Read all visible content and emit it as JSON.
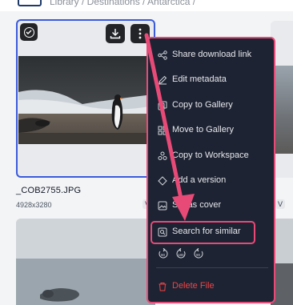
{
  "header": {
    "breadcrumb": "Library / Destinations / Antarctica /"
  },
  "selected_asset": {
    "filename": "_COB2755.JPG",
    "dimensions": "4928x3280",
    "version_tag": "V"
  },
  "right_asset": {
    "version_tag": "V"
  },
  "context_menu": {
    "items": [
      {
        "label": "Share download link",
        "icon": "share-icon"
      },
      {
        "label": "Edit metadata",
        "icon": "edit-icon"
      },
      {
        "label": "Copy to Gallery",
        "icon": "copy-icon"
      },
      {
        "label": "Move to Gallery",
        "icon": "move-icon"
      },
      {
        "label": "Copy to Workspace",
        "icon": "workspace-icon"
      },
      {
        "label": "Add a version",
        "icon": "version-icon"
      },
      {
        "label": "Set as cover",
        "icon": "image-icon"
      },
      {
        "label": "Search for similar",
        "icon": "search-similar-icon"
      }
    ],
    "rotate_labels": [
      "90",
      "180",
      "90"
    ],
    "delete_label": "Delete File"
  },
  "colors": {
    "menu_bg": "#1e2333",
    "highlight": "#e84a77",
    "selection_border": "#3b5bdb",
    "danger": "#ef4444"
  }
}
